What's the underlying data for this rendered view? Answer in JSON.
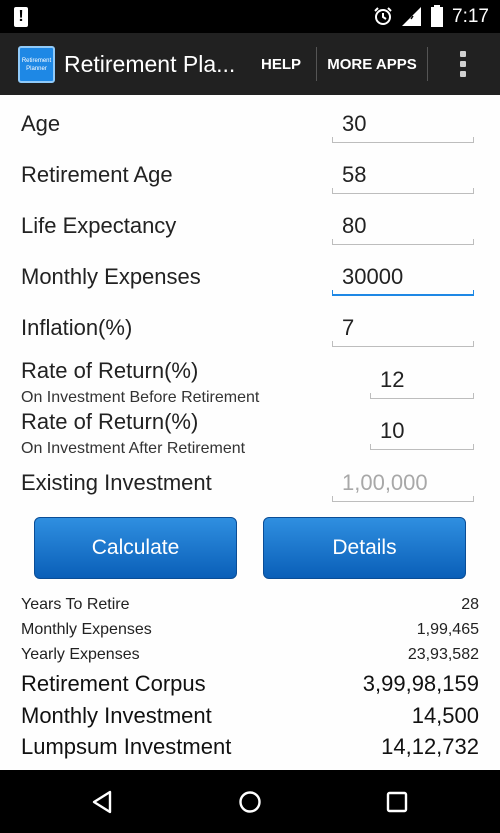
{
  "status_bar": {
    "time": "7:17",
    "icons": [
      "warning-icon",
      "alarm-icon",
      "signal-icon",
      "battery-icon"
    ]
  },
  "action_bar": {
    "logo_text": "Retirement Planner",
    "title": "Retirement Pla...",
    "help_label": "HELP",
    "more_apps_label": "MORE APPS",
    "overflow_icon": "overflow-menu-icon"
  },
  "form": {
    "age": {
      "label": "Age",
      "value": "30"
    },
    "retirement_age": {
      "label": "Retirement Age",
      "value": "58"
    },
    "life_expectancy": {
      "label": "Life Expectancy",
      "value": "80"
    },
    "monthly_expenses": {
      "label": "Monthly Expenses",
      "value": "30000"
    },
    "inflation": {
      "label": "Inflation(%)",
      "value": "7"
    },
    "return_before": {
      "label": "Rate of Return(%)",
      "sublabel": "On Investment Before Retirement",
      "value": "12"
    },
    "return_after": {
      "label": "Rate of Return(%)",
      "sublabel": "On Investment After Retirement",
      "value": "10"
    },
    "existing_investment": {
      "label": "Existing Investment",
      "placeholder": "1,00,000"
    }
  },
  "buttons": {
    "calculate": "Calculate",
    "details": "Details"
  },
  "results": {
    "years_to_retire": {
      "label": "Years To Retire",
      "value": "28"
    },
    "monthly_expenses": {
      "label": "Monthly Expenses",
      "value": "1,99,465"
    },
    "yearly_expenses": {
      "label": "Yearly Expenses",
      "value": "23,93,582"
    },
    "retirement_corpus": {
      "label": "Retirement Corpus",
      "value": "3,99,98,159"
    },
    "monthly_investment": {
      "label": "Monthly Investment",
      "value": "14,500"
    },
    "lumpsum_investment": {
      "label": "Lumpsum Investment",
      "value": "14,12,732"
    }
  },
  "colors": {
    "accent": "#1e88e5",
    "button": "#0a5fb8",
    "action_bar": "#212121"
  },
  "nav_bar": {
    "icons": [
      "back-icon",
      "home-icon",
      "recent-apps-icon"
    ]
  }
}
